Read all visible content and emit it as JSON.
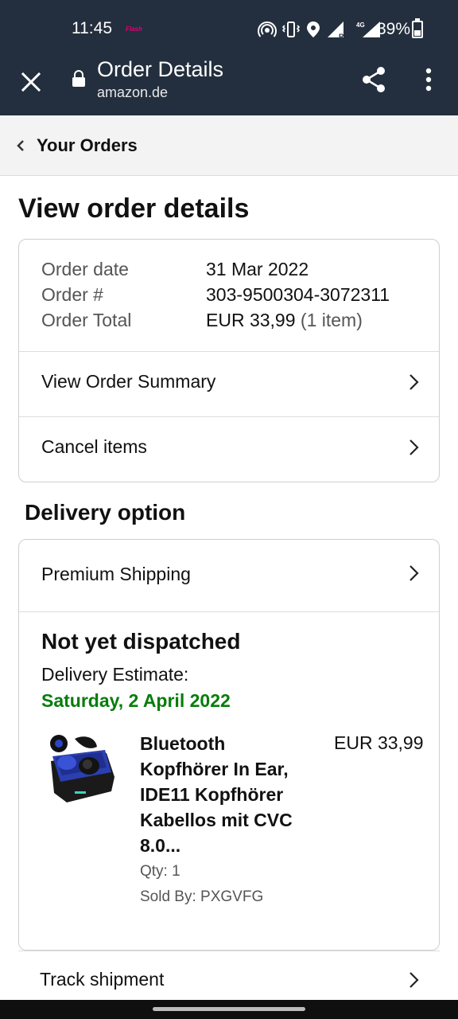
{
  "status_bar": {
    "time": "11:45",
    "carrier_badge": "Flash",
    "battery": "39%",
    "icons": [
      "hotspot-icon",
      "vibrate-icon",
      "location-icon",
      "signal-r-icon",
      "signal-4g-icon",
      "battery-charging-icon"
    ]
  },
  "app_bar": {
    "title": "Order Details",
    "domain": "amazon.de",
    "icons": [
      "close-icon",
      "lock-icon",
      "share-icon",
      "more-vert-icon"
    ]
  },
  "breadcrumb": {
    "label": "Your Orders"
  },
  "page": {
    "title": "View order details"
  },
  "order_info": {
    "date_label": "Order date",
    "date_value": "31 Mar 2022",
    "number_label": "Order #",
    "number_value": "303-9500304-3072311",
    "total_label": "Order Total",
    "total_value": "EUR 33,99",
    "total_items": "(1 item)"
  },
  "links": {
    "summary": "View Order Summary",
    "cancel": "Cancel items"
  },
  "delivery": {
    "section_title": "Delivery option",
    "shipping": "Premium Shipping",
    "status": "Not yet dispatched",
    "estimate_label": "Delivery Estimate:",
    "estimate_date": "Saturday, 2 April 2022",
    "estimate_color": "#067d0a"
  },
  "product": {
    "name": "Bluetooth Kopfhörer In Ear, IDE11 Kopfhörer Kabellos mit CVC 8.0...",
    "price": "EUR 33,99",
    "qty": "Qty: 1",
    "seller": "Sold By: PXGVFG"
  },
  "track": {
    "label": "Track shipment"
  },
  "colors": {
    "header_bg": "#232f3e",
    "breadcrumb_bg": "#f3f3f3",
    "accent_green": "#067d0a"
  }
}
